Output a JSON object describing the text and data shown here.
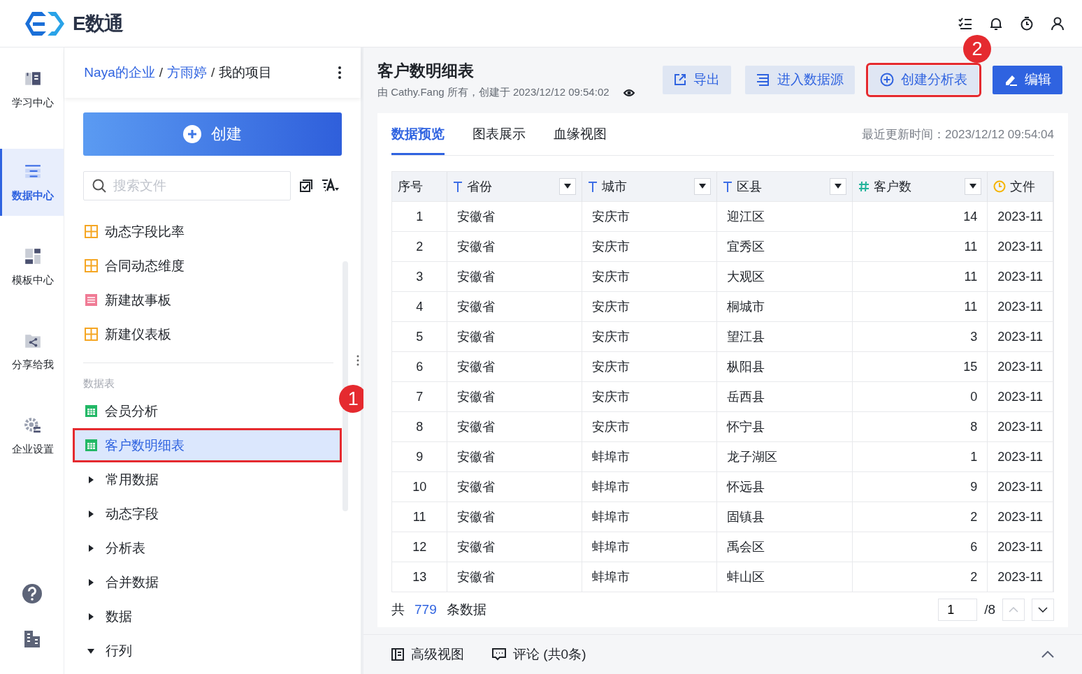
{
  "app": {
    "logo_text": "E数通"
  },
  "nav": [
    {
      "label": "学习中心",
      "selected": false
    },
    {
      "label": "数据中心",
      "selected": true
    },
    {
      "label": "模板中心",
      "selected": false
    },
    {
      "label": "分享给我",
      "selected": false
    },
    {
      "label": "企业设置",
      "selected": false
    }
  ],
  "sidebar": {
    "breadcrumb_separator": "/",
    "breadcrumb": [
      {
        "label": "Naya的企业",
        "link": true
      },
      {
        "label": "方雨婷",
        "link": true
      },
      {
        "label": "我的项目",
        "link": false
      }
    ],
    "create_button": "创建",
    "search": {
      "placeholder": "搜索文件"
    },
    "items": [
      {
        "label": "动态字段比率",
        "kind": "dashboard"
      },
      {
        "label": "合同动态维度",
        "kind": "dashboard"
      },
      {
        "label": "新建故事板",
        "kind": "story"
      },
      {
        "label": "新建仪表板",
        "kind": "dashboard"
      }
    ],
    "section_title": "数据表",
    "tables": [
      {
        "label": "会员分析",
        "kind": "table",
        "selected": false,
        "highlighted": false
      },
      {
        "label": "客户数明细表",
        "kind": "table",
        "selected": true,
        "highlighted": true
      },
      {
        "label": "常用数据",
        "kind": "folder",
        "expanded": false,
        "selected": false,
        "highlighted": false
      },
      {
        "label": "动态字段",
        "kind": "folder",
        "expanded": false,
        "selected": false,
        "highlighted": false
      },
      {
        "label": "分析表",
        "kind": "folder",
        "expanded": false,
        "selected": false,
        "highlighted": false
      },
      {
        "label": "合并数据",
        "kind": "folder",
        "expanded": false,
        "selected": false,
        "highlighted": false
      },
      {
        "label": "数据",
        "kind": "folder",
        "expanded": false,
        "selected": false,
        "highlighted": false
      },
      {
        "label": "行列",
        "kind": "folder",
        "expanded": true,
        "selected": false,
        "highlighted": false
      }
    ]
  },
  "annotations": [
    "1",
    "2"
  ],
  "main": {
    "title": "客户数明细表",
    "subtitle": "由 Cathy.Fang 所有，创建于 2023/12/12 09:54:02",
    "buttons": [
      {
        "label": "导出",
        "kind": "export",
        "primary": false,
        "highlighted": false
      },
      {
        "label": "进入数据源",
        "kind": "source",
        "primary": false,
        "highlighted": false
      },
      {
        "label": "创建分析表",
        "kind": "create",
        "primary": false,
        "highlighted": true
      },
      {
        "label": "编辑",
        "kind": "edit",
        "primary": true,
        "highlighted": false
      }
    ],
    "tabs": [
      {
        "label": "数据预览",
        "selected": true
      },
      {
        "label": "图表展示",
        "selected": false
      },
      {
        "label": "血缘视图",
        "selected": false
      }
    ],
    "updated": "最近更新时间：2023/12/12 09:54:04",
    "table": {
      "columns": [
        {
          "label": "序号",
          "kind": "index"
        },
        {
          "label": "省份",
          "kind": "text"
        },
        {
          "label": "城市",
          "kind": "text"
        },
        {
          "label": "区县",
          "kind": "text"
        },
        {
          "label": "客户数",
          "kind": "number"
        },
        {
          "label": "文件",
          "kind": "date"
        }
      ],
      "rows": [
        [
          "1",
          "安徽省",
          "安庆市",
          "迎江区",
          "14",
          "2023-11"
        ],
        [
          "2",
          "安徽省",
          "安庆市",
          "宜秀区",
          "11",
          "2023-11"
        ],
        [
          "3",
          "安徽省",
          "安庆市",
          "大观区",
          "11",
          "2023-11"
        ],
        [
          "4",
          "安徽省",
          "安庆市",
          "桐城市",
          "11",
          "2023-11"
        ],
        [
          "5",
          "安徽省",
          "安庆市",
          "望江县",
          "3",
          "2023-11"
        ],
        [
          "6",
          "安徽省",
          "安庆市",
          "枞阳县",
          "15",
          "2023-11"
        ],
        [
          "7",
          "安徽省",
          "安庆市",
          "岳西县",
          "0",
          "2023-11"
        ],
        [
          "8",
          "安徽省",
          "安庆市",
          "怀宁县",
          "8",
          "2023-11"
        ],
        [
          "9",
          "安徽省",
          "蚌埠市",
          "龙子湖区",
          "1",
          "2023-11"
        ],
        [
          "10",
          "安徽省",
          "蚌埠市",
          "怀远县",
          "9",
          "2023-11"
        ],
        [
          "11",
          "安徽省",
          "蚌埠市",
          "固镇县",
          "2",
          "2023-11"
        ],
        [
          "12",
          "安徽省",
          "蚌埠市",
          "禹会区",
          "6",
          "2023-11"
        ],
        [
          "13",
          "安徽省",
          "蚌埠市",
          "蚌山区",
          "2",
          "2023-11"
        ]
      ]
    },
    "footer": {
      "prefix": "共",
      "count": "779",
      "suffix": "条数据",
      "page": "1",
      "pages": "/8"
    },
    "bottom_tabs": [
      {
        "label": "高级视图",
        "kind": "view"
      },
      {
        "label": "评论 (共0条)",
        "kind": "comment"
      }
    ]
  }
}
